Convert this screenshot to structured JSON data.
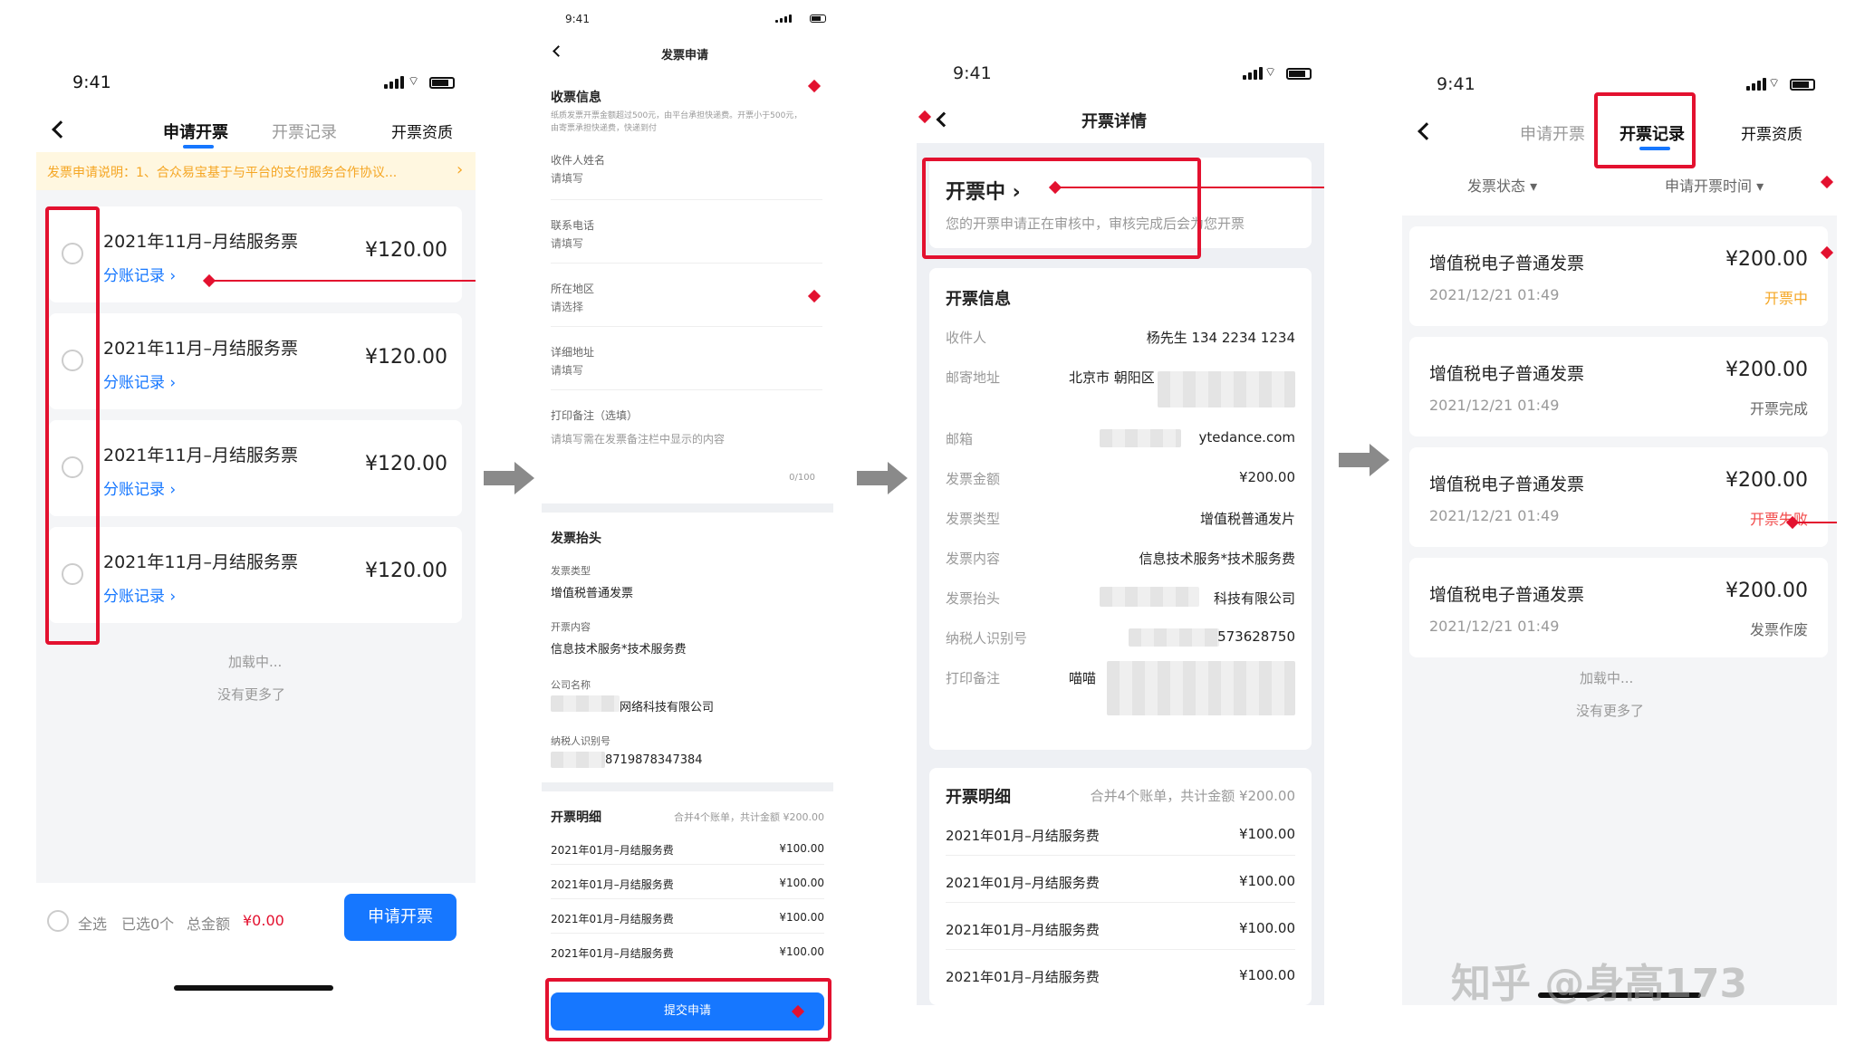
{
  "status": {
    "time": "9:41"
  },
  "screen1": {
    "tabs": [
      "申请开票",
      "开票记录",
      "开票资质"
    ],
    "notice": "发票申请说明：1、合众易宝基于与平台的支付服务合作协议...",
    "notice_arrow": "›",
    "items": [
      {
        "title": "2021年11月–月结服务票",
        "link": "分账记录 ›",
        "amount": "¥120.00"
      },
      {
        "title": "2021年11月–月结服务票",
        "link": "分账记录 ›",
        "amount": "¥120.00"
      },
      {
        "title": "2021年11月–月结服务票",
        "link": "分账记录 ›",
        "amount": "¥120.00"
      },
      {
        "title": "2021年11月–月结服务票",
        "link": "分账记录 ›",
        "amount": "¥120.00"
      }
    ],
    "loading": "加载中...",
    "no_more": "没有更多了",
    "footer": {
      "select_all": "全选",
      "selected": "已选0个",
      "total_label": "总金额",
      "total": "¥0.00",
      "apply": "申请开票"
    }
  },
  "screen2": {
    "title": "发票申请",
    "recv_title": "收票信息",
    "recv_desc": "纸质发票开票金额超过500元，由平台承担快递费。开票小于500元，由寄票承担快递费，快递到付",
    "fields": [
      {
        "label": "收件人姓名",
        "placeholder": "请填写"
      },
      {
        "label": "联系电话",
        "placeholder": "请填写"
      },
      {
        "label": "所在地区",
        "placeholder": "请选择"
      },
      {
        "label": "详细地址",
        "placeholder": "请填写"
      }
    ],
    "remark_label": "打印备注（选填）",
    "remark_placeholder": "请填写需在发票备注栏中显示的内容",
    "remark_count": "0/100",
    "head_title": "发票抬头",
    "head_fields": [
      {
        "label": "发票类型",
        "value": "增值税普通发票"
      },
      {
        "label": "开票内容",
        "value": "信息技术服务*技术服务费"
      },
      {
        "label": "公司名称",
        "value": "网络科技有限公司"
      },
      {
        "label": "纳税人识别号",
        "value": "8719878347384"
      }
    ],
    "detail_title": "开票明细",
    "detail_summary": "合并4个账单，共计金额 ¥200.00",
    "detail_rows": [
      {
        "name": "2021年01月–月结服务费",
        "amount": "¥100.00"
      },
      {
        "name": "2021年01月–月结服务费",
        "amount": "¥100.00"
      },
      {
        "name": "2021年01月–月结服务费",
        "amount": "¥100.00"
      },
      {
        "name": "2021年01月–月结服务费",
        "amount": "¥100.00"
      }
    ],
    "submit": "提交申请"
  },
  "screen3": {
    "title": "开票详情",
    "state": "开票中 ›",
    "state_desc": "您的开票申请正在审核中，审核完成后会为您开票",
    "info_title": "开票信息",
    "info": [
      {
        "label": "收件人",
        "value": "杨先生  134 2234 1234"
      },
      {
        "label": "邮寄地址",
        "value": "北京市 朝阳区"
      },
      {
        "label": "邮箱",
        "value": "ytedance.com"
      },
      {
        "label": "发票金额",
        "value": "¥200.00"
      },
      {
        "label": "发票类型",
        "value": "增值税普通发片"
      },
      {
        "label": "发票内容",
        "value": "信息技术服务*技术服务费"
      },
      {
        "label": "发票抬头",
        "value": "科技有限公司"
      },
      {
        "label": "纳税人识别号",
        "value": "573628750"
      },
      {
        "label": "打印备注",
        "value": "喵喵"
      }
    ],
    "detail_title": "开票明细",
    "detail_summary": "合并4个账单，共计金额 ¥200.00",
    "detail_rows": [
      {
        "name": "2021年01月–月结服务费",
        "amount": "¥100.00"
      },
      {
        "name": "2021年01月–月结服务费",
        "amount": "¥100.00"
      },
      {
        "name": "2021年01月–月结服务费",
        "amount": "¥100.00"
      },
      {
        "name": "2021年01月–月结服务费",
        "amount": "¥100.00"
      }
    ]
  },
  "screen4": {
    "tabs": [
      "申请开票",
      "开票记录",
      "开票资质"
    ],
    "filters": [
      "发票状态 ▾",
      "申请开票时间 ▾"
    ],
    "records": [
      {
        "title": "增值税电子普通发票",
        "amount": "¥200.00",
        "date": "2021/12/21  01:49",
        "status": "开票中",
        "status_color": "#f5a623"
      },
      {
        "title": "增值税电子普通发票",
        "amount": "¥200.00",
        "date": "2021/12/21  01:49",
        "status": "开票完成",
        "status_color": "#666666"
      },
      {
        "title": "增值税电子普通发票",
        "amount": "¥200.00",
        "date": "2021/12/21  01:49",
        "status": "开票失败",
        "status_color": "#f24a4a"
      },
      {
        "title": "增值税电子普通发票",
        "amount": "¥200.00",
        "date": "2021/12/21  01:49",
        "status": "发票作废",
        "status_color": "#666666"
      }
    ],
    "loading": "加载中...",
    "no_more": "没有更多了"
  },
  "watermark": "知乎 @身高173",
  "colors": {
    "accent": "#1677ff",
    "annotation": "#e3112f",
    "price": "#e3112f",
    "notice": "#f5a623"
  }
}
